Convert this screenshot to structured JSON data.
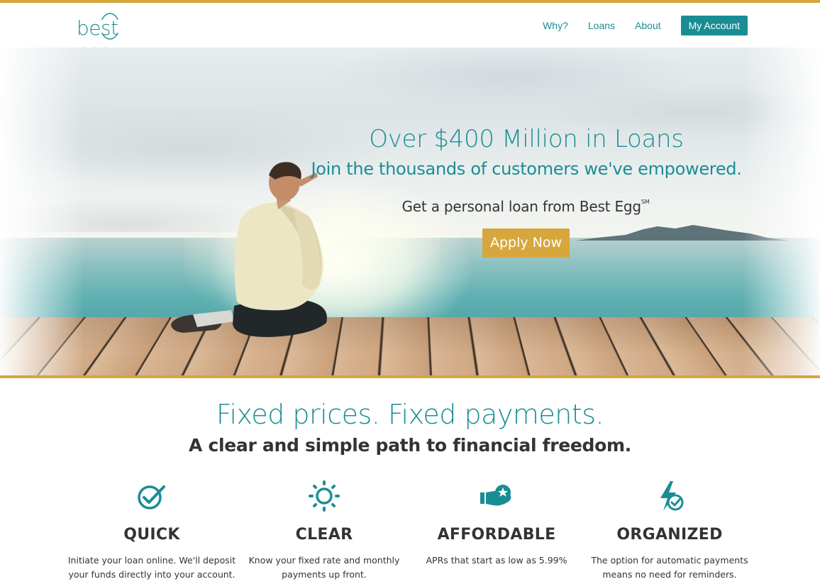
{
  "header": {
    "logo_text": "best egg",
    "nav": [
      {
        "label": "Why?"
      },
      {
        "label": "Loans"
      },
      {
        "label": "About"
      }
    ],
    "account_button": "My Account"
  },
  "hero": {
    "title": "Over $400 Million in Loans",
    "subtitle": "Join the thousands of customers we've empowered.",
    "tagline": "Get a personal loan from Best Egg",
    "tagline_mark": "SM",
    "cta": "Apply Now"
  },
  "section": {
    "title": "Fixed prices. Fixed payments.",
    "subtitle": "A clear and simple path to financial freedom."
  },
  "features": [
    {
      "icon": "check-circle-icon",
      "title": "QUICK",
      "text": "Initiate your loan online. We'll deposit your funds directly into your account."
    },
    {
      "icon": "sun-icon",
      "title": "CLEAR",
      "text": "Know your fixed rate and monthly payments up front."
    },
    {
      "icon": "hand-star-icon",
      "title": "AFFORDABLE",
      "text": "APRs that start as low as 5.99%"
    },
    {
      "icon": "lightning-check-icon",
      "title": "ORGANIZED",
      "text": "The option for automatic payments means no need for reminders."
    }
  ],
  "colors": {
    "brand_teal": "#1a8d94",
    "accent_gold": "#d4a73a",
    "cta_gold": "#d7a73d",
    "text_dark": "#333333"
  }
}
